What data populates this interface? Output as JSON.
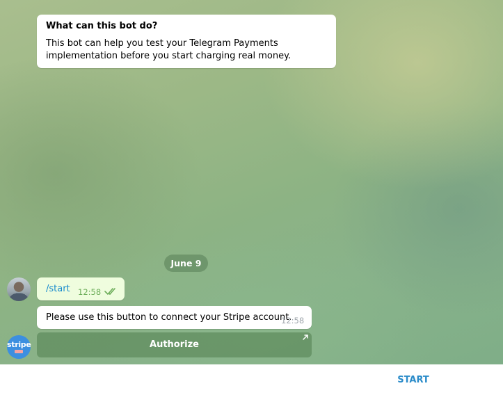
{
  "intro": {
    "title": "What can this bot do?",
    "body": "This bot can help you test your Telegram Payments implementation before you start charging real money."
  },
  "date_separator": "June 9",
  "messages": {
    "outgoing": {
      "text": "/start",
      "time": "12:58",
      "status": "read-double-check"
    },
    "incoming": {
      "text": "Please use this button to connect your Stripe account.",
      "time": "12:58"
    }
  },
  "bot_avatar": {
    "label": "stripe",
    "color": "#3c8fe0"
  },
  "inline_keyboard": {
    "button_label": "Authorize",
    "icon": "external-link-arrow-icon"
  },
  "bottom_bar": {
    "start_label": "START"
  },
  "colors": {
    "link": "#168acd",
    "outgoing_bubble": "#effdde",
    "check_green": "#6cad59",
    "start_blue": "#2a8bc9"
  }
}
